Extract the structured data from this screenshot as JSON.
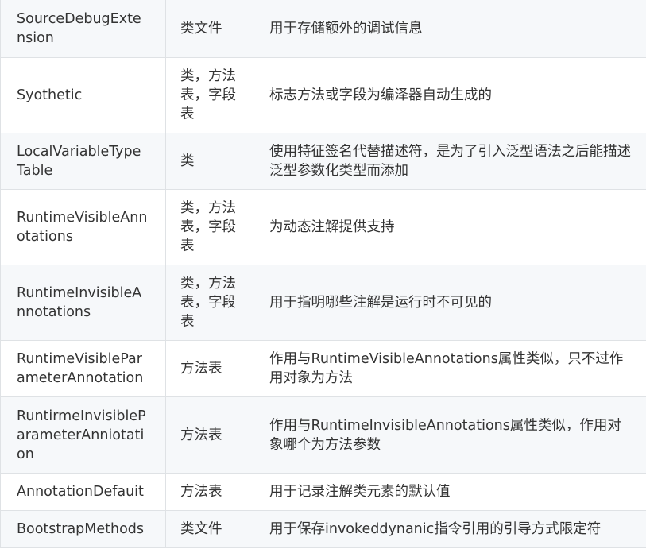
{
  "rows": [
    {
      "name": "SourceDebugExtension",
      "type": "类文件",
      "desc": "用于存储额外的调试信息"
    },
    {
      "name": "Syothetic",
      "type": "类，方法表，字段表",
      "desc": "标志方法或字段为编泽器自动生成的"
    },
    {
      "name": "LocalVariableTypeTable",
      "type": "类",
      "desc": "使用特征签名代替描述符，是为了引入泛型语法之后能描述泛型参数化类型而添加"
    },
    {
      "name": "RuntimeVisibleAnnotations",
      "type": "类，方法表，字段表",
      "desc": "为动态注解提供支持"
    },
    {
      "name": "RuntimeInvisibleAnnotations",
      "type": "类，方法表，字段表",
      "desc": "用于指明哪些注解是运行时不可见的"
    },
    {
      "name": "RuntimeVisibleParameterAnnotation",
      "type": "方法表",
      "desc": "作用与RuntimeVisibleAnnotations属性类似，只不过作用对象为方法"
    },
    {
      "name": "RuntirmeInvisibleParameterAnniotation",
      "type": "方法表",
      "desc": "作用与RuntimeInvisibleAnnotations属性类似，作用对象哪个为方法参数"
    },
    {
      "name": "AnnotationDefauit",
      "type": "方法表",
      "desc": "用于记录注解类元素的默认值"
    },
    {
      "name": "BootstrapMethods",
      "type": "类文件",
      "desc": "用于保存invokeddynanic指令引用的引导方式限定符"
    }
  ]
}
